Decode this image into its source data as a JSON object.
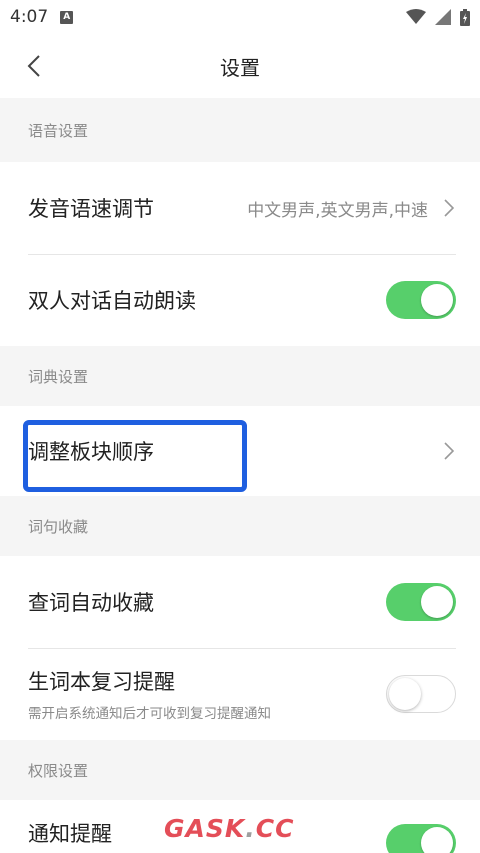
{
  "status_bar": {
    "time": "4:07",
    "notification_icon": "A"
  },
  "nav": {
    "title": "设置",
    "back_icon": "chevron-left-icon"
  },
  "sections": {
    "voice": {
      "header": "语音设置",
      "pronunciation_label": "发音语速调节",
      "pronunciation_value": "中文男声,英文男声,中速",
      "dialogue_label": "双人对话自动朗读",
      "dialogue_toggle": true
    },
    "dictionary": {
      "header": "词典设置",
      "reorder_label": "调整板块顺序"
    },
    "favorites": {
      "header": "词句收藏",
      "auto_collect_label": "查词自动收藏",
      "auto_collect_toggle": true,
      "review_label": "生词本复习提醒",
      "review_sub": "需开启系统通知后才可收到复习提醒通知",
      "review_toggle": false
    },
    "permissions": {
      "header": "权限设置",
      "notify_label": "通知提醒",
      "notify_toggle": true
    }
  },
  "watermark": {
    "left": "GASK",
    "dot": ".",
    "right": "CC"
  },
  "colors": {
    "toggle_on": "#57cf6b",
    "highlight": "#1f5fe0",
    "watermark": "#e0303c"
  }
}
